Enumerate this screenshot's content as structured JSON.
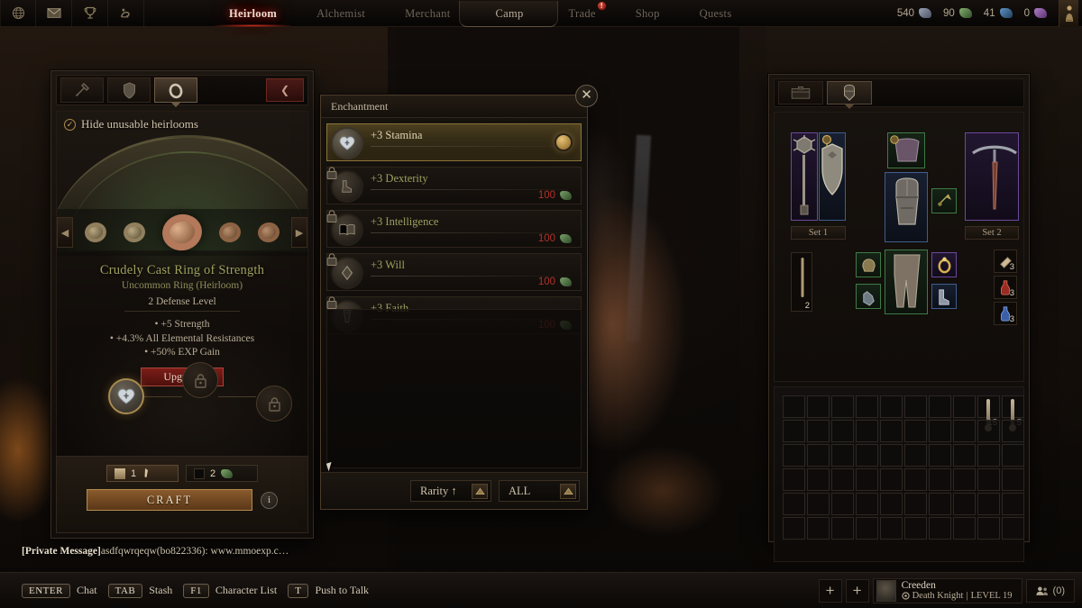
{
  "topbar": {
    "icons": [
      {
        "name": "world-icon",
        "glyph": "globe"
      },
      {
        "name": "mail-icon",
        "glyph": "envelope"
      },
      {
        "name": "trophy-icon",
        "glyph": "trophy"
      },
      {
        "name": "emote-icon",
        "glyph": "flex"
      }
    ],
    "tabs": [
      {
        "label": "Heirloom",
        "active": true
      },
      {
        "label": "Alchemist",
        "active": false
      },
      {
        "label": "Merchant",
        "active": false
      },
      {
        "label": "Camp",
        "active": false
      },
      {
        "label": "Trade",
        "active": false,
        "alert": "!"
      },
      {
        "label": "Shop",
        "active": false
      },
      {
        "label": "Quests",
        "active": false
      }
    ],
    "currencies": [
      {
        "value": "540",
        "color": "#8d94a6",
        "name": "silver-shard"
      },
      {
        "value": "90",
        "color": "#6f9a5e",
        "name": "green-shard"
      },
      {
        "value": "41",
        "color": "#4d7fae",
        "name": "blue-shard"
      },
      {
        "value": "0",
        "color": "#9a6aae",
        "name": "purple-shard"
      }
    ]
  },
  "heirloom": {
    "tabs": [
      {
        "name": "weapon-tab",
        "active": false
      },
      {
        "name": "armor-tab",
        "active": false
      },
      {
        "name": "ring-tab",
        "active": true
      }
    ],
    "back_label": "❮",
    "hide_unusable_label": "Hide unusable heirlooms",
    "hide_unusable_checked": true,
    "item": {
      "title": "Crudely Cast Ring of Strength",
      "subtitle": "Uncommon Ring (Heirloom)",
      "defense": "2 Defense Level",
      "stats": [
        "•  +5 Strength",
        "•  +4.3% All Elemental Resistances",
        "•  +50% EXP Gain"
      ],
      "upgrade_label": "Upgrade",
      "title_color": "#9fa05e"
    },
    "nodes": [
      {
        "name": "node-stamina",
        "unlocked": true
      },
      {
        "name": "node-locked-1",
        "unlocked": false
      },
      {
        "name": "node-locked-2",
        "unlocked": false
      }
    ],
    "costs": [
      {
        "amount": "1",
        "name": "bone-cost"
      },
      {
        "amount": "2",
        "name": "shard-cost"
      }
    ],
    "craft_label": "CRAFT",
    "info_label": "i"
  },
  "enchantment": {
    "title": "Enchantment",
    "close_label": "✕",
    "rows": [
      {
        "name": "+3 Stamina",
        "selected": true,
        "locked": false,
        "cost": "",
        "icon": "heart-icon"
      },
      {
        "name": "+3 Dexterity",
        "selected": false,
        "locked": true,
        "cost": "100",
        "icon": "boot-icon"
      },
      {
        "name": "+3 Intelligence",
        "selected": false,
        "locked": true,
        "cost": "100",
        "icon": "book-icon"
      },
      {
        "name": "+3 Will",
        "selected": false,
        "locked": true,
        "cost": "100",
        "icon": "gem-icon"
      },
      {
        "name": "+3 Faith",
        "selected": false,
        "locked": true,
        "cost": "100",
        "icon": "scroll-icon"
      }
    ],
    "sort_label": "Rarity ↑",
    "filter_label": "ALL"
  },
  "inventory": {
    "tabs": [
      {
        "name": "stash-tab",
        "active": false
      },
      {
        "name": "equipment-tab",
        "active": true
      }
    ],
    "set_labels": [
      "Set 1",
      "Set 2"
    ],
    "equipped": [
      {
        "name": "mace-slot",
        "rarity": "epic"
      },
      {
        "name": "shield-slot",
        "rarity": "rare"
      },
      {
        "name": "cape-slot",
        "rarity": "uncom"
      },
      {
        "name": "chest-slot",
        "rarity": "rare"
      },
      {
        "name": "charm-slot",
        "rarity": "uncom"
      },
      {
        "name": "pickaxe-slot",
        "rarity": "epic"
      },
      {
        "name": "helmet-slot",
        "rarity": "uncom"
      },
      {
        "name": "gloves-slot",
        "rarity": "uncom"
      },
      {
        "name": "legs-slot",
        "rarity": "uncom"
      },
      {
        "name": "ring-slot",
        "rarity": "epic"
      },
      {
        "name": "boots-slot",
        "rarity": "rare"
      }
    ],
    "quickslots": [
      {
        "name": "bandage-quickslot",
        "qty": "3"
      },
      {
        "name": "health-potion-quickslot",
        "qty": "3"
      },
      {
        "name": "mana-potion-quickslot",
        "qty": "3"
      }
    ],
    "torch_qty": "2",
    "grid": {
      "cols": 10,
      "rows": 6
    },
    "grid_items": [
      {
        "name": "bone-stack-a",
        "col": 9,
        "row": 1,
        "qty": "15"
      },
      {
        "name": "bone-stack-b",
        "col": 10,
        "row": 1,
        "qty": "5"
      }
    ]
  },
  "chat": {
    "prefix": "[Private Message]",
    "message": "asdfqwrqeqw(bo822336): www.mmoexp.c…"
  },
  "bottombar": {
    "keys": [
      {
        "key": "ENTER",
        "label": "Chat"
      },
      {
        "key": "TAB",
        "label": "Stash"
      },
      {
        "key": "F1",
        "label": "Character List"
      },
      {
        "key": "T",
        "label": "Push to Talk"
      }
    ],
    "add_buttons": [
      "+",
      "+"
    ],
    "character": {
      "name": "Creeden",
      "class": "Death Knight",
      "level": "LEVEL 19",
      "separator": "|"
    },
    "party_count": "(0)"
  }
}
